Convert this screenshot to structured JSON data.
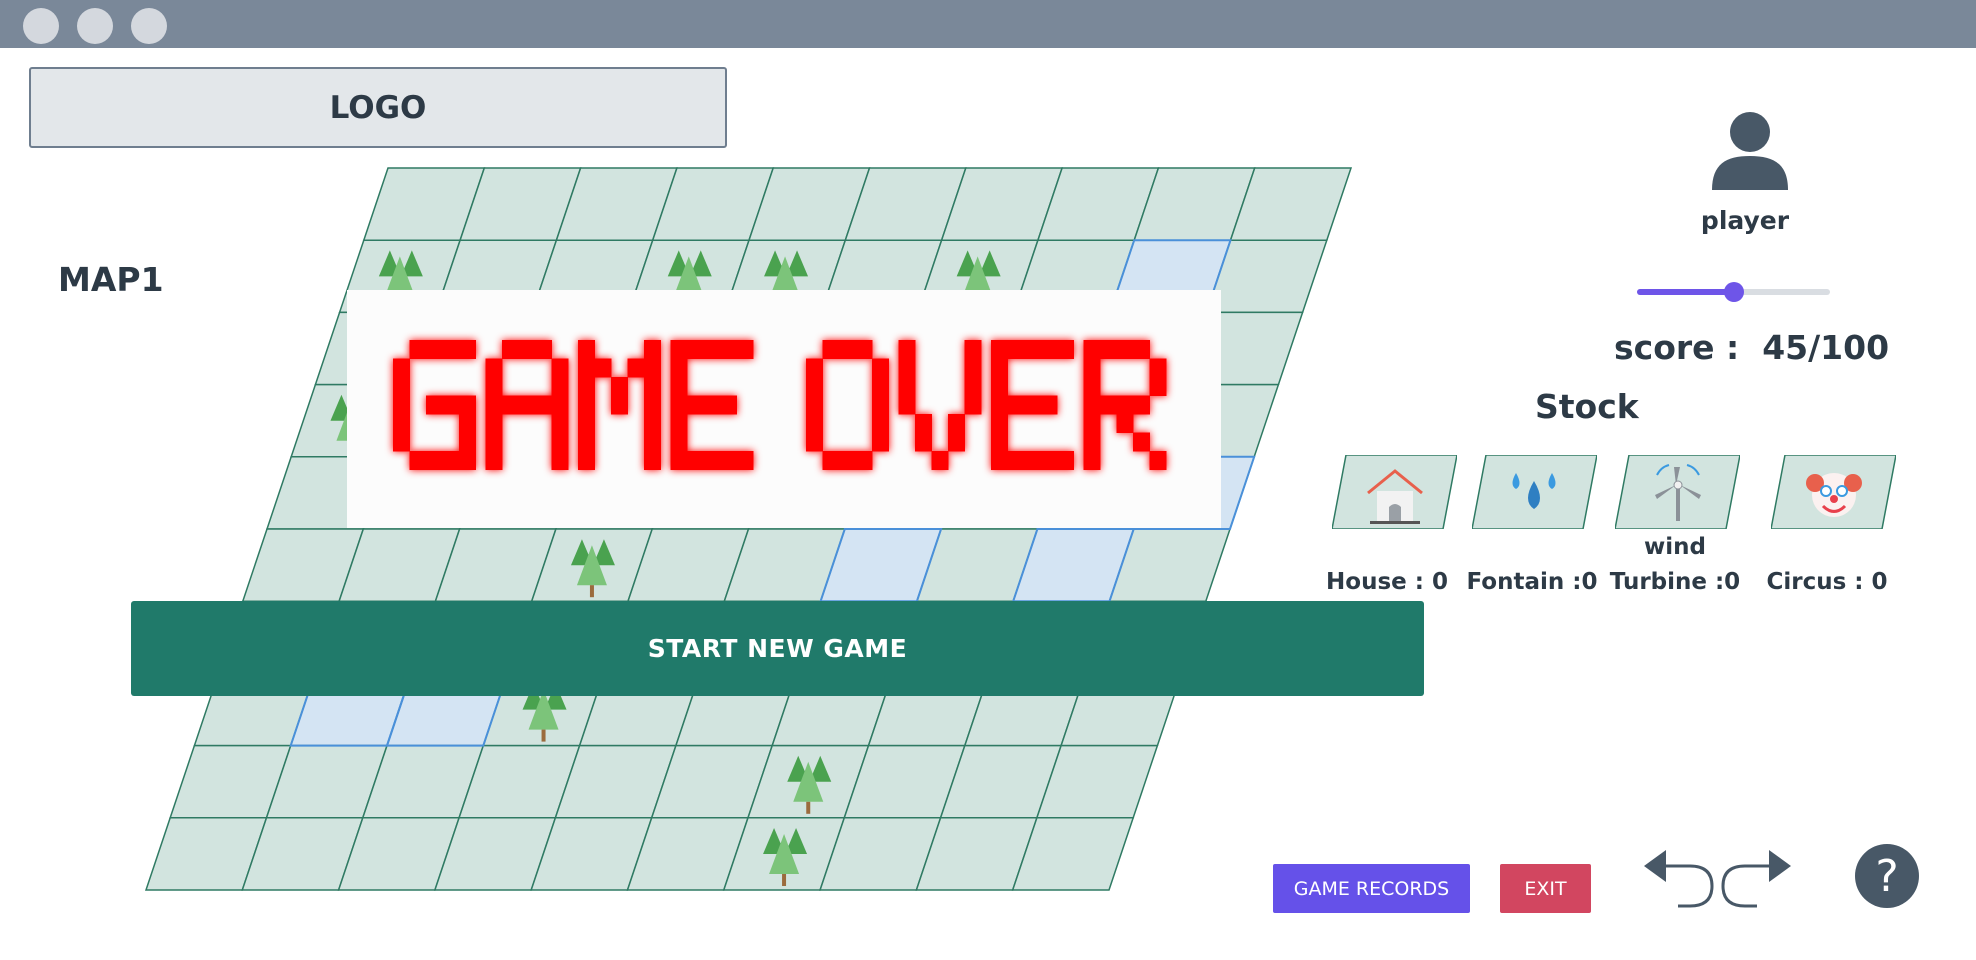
{
  "window": {
    "controls": [
      "close",
      "minimize",
      "maximize"
    ]
  },
  "logo": {
    "label": "LOGO"
  },
  "map": {
    "title": "MAP1",
    "rows": 10,
    "cols": 10,
    "colors": {
      "tile": "#d2e4df",
      "highlight": "#d4e4f3",
      "border": "#2f7a63",
      "highlight_border": "#4a90d9"
    },
    "highlighted_cells": [
      [
        1,
        8
      ],
      [
        4,
        9
      ],
      [
        5,
        6
      ],
      [
        5,
        8
      ],
      [
        7,
        1
      ],
      [
        7,
        2
      ]
    ],
    "tree_cells": [
      [
        1,
        0
      ],
      [
        1,
        3
      ],
      [
        1,
        4
      ],
      [
        1,
        6
      ],
      [
        3,
        0
      ],
      [
        5,
        3
      ],
      [
        7,
        3
      ],
      [
        8,
        6
      ],
      [
        9,
        6
      ]
    ]
  },
  "overlay": {
    "game_over_image": "GAME OVER",
    "game_over_color": "#ff0000"
  },
  "start_button": {
    "label": "START NEW GAME",
    "color": "#207a6a"
  },
  "player": {
    "icon": "user-icon",
    "name": "player",
    "level": 0.5
  },
  "score": {
    "label": "score :",
    "value": "45/100"
  },
  "stock": {
    "title": "Stock",
    "items": [
      {
        "icon": "house-icon",
        "label": "House : 0"
      },
      {
        "icon": "fountain-icon",
        "label": "Fontain :0"
      },
      {
        "icon": "wind-turbine-icon",
        "label": "wind\nTurbine :0"
      },
      {
        "icon": "circus-icon",
        "label": "Circus : 0"
      }
    ]
  },
  "buttons": {
    "records": {
      "label": "GAME RECORDS",
      "color": "#6551e9"
    },
    "exit": {
      "label": "EXIT",
      "color": "#d24660"
    }
  },
  "controls": {
    "undo": "undo-icon",
    "redo": "redo-icon",
    "help": "?"
  }
}
